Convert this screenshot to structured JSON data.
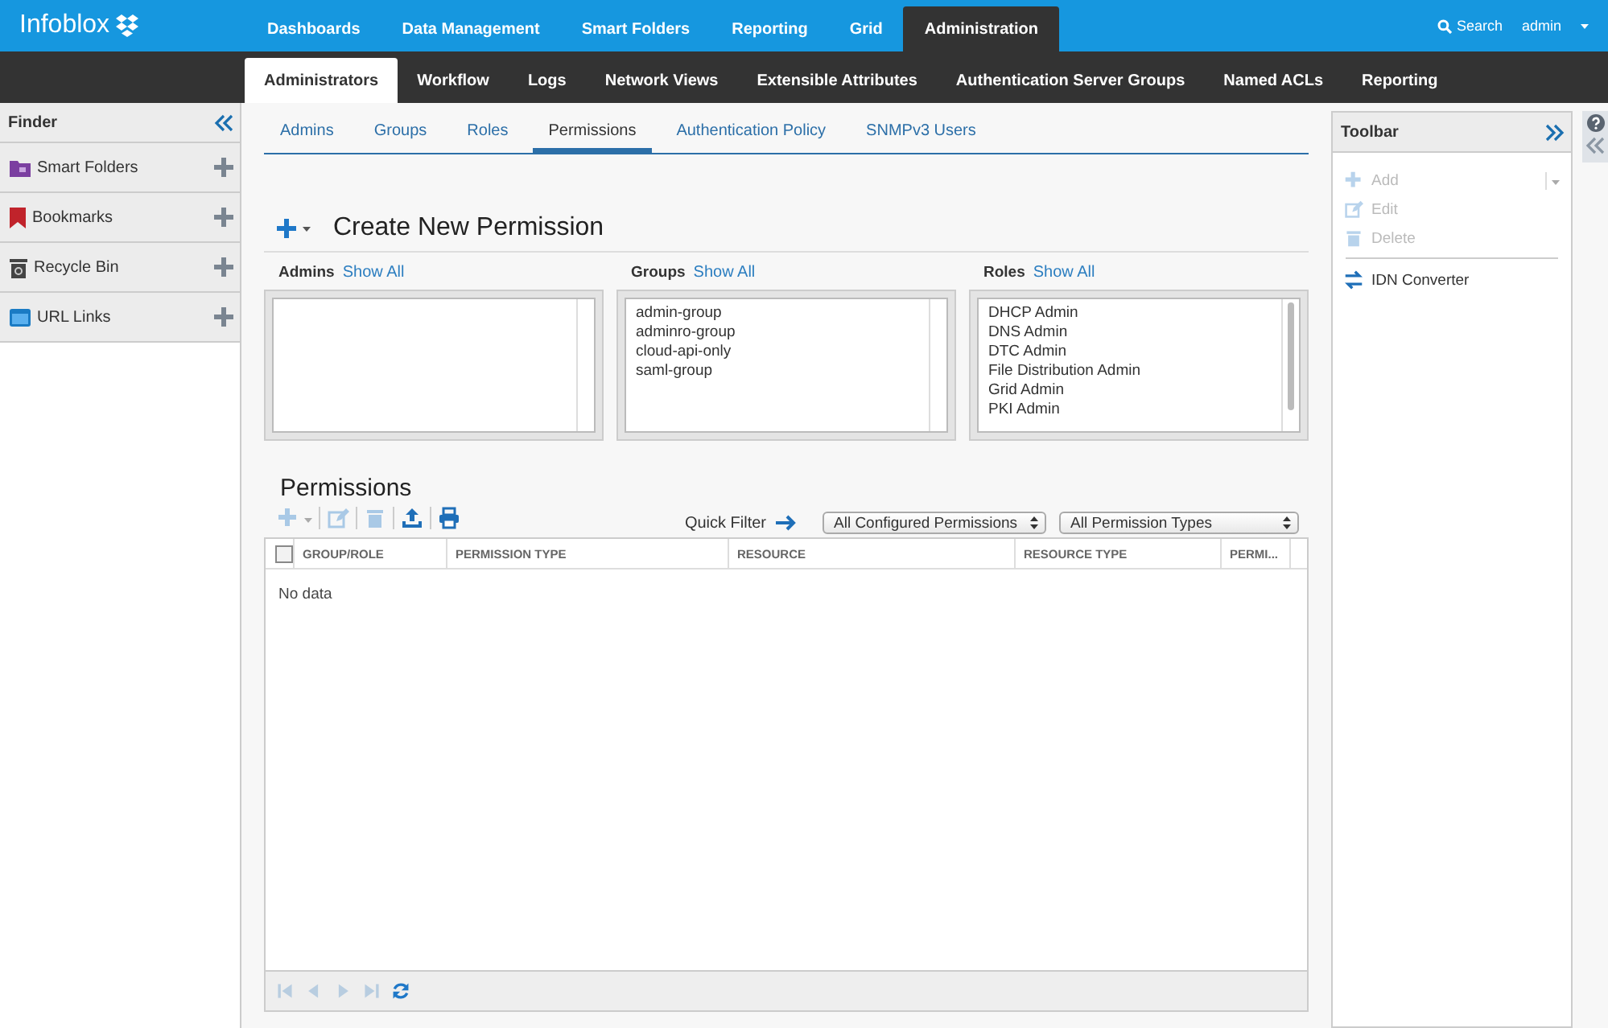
{
  "header": {
    "logo": "Infoblox",
    "nav": [
      {
        "label": "Dashboards",
        "selected": false
      },
      {
        "label": "Data Management",
        "selected": false
      },
      {
        "label": "Smart Folders",
        "selected": false
      },
      {
        "label": "Reporting",
        "selected": false
      },
      {
        "label": "Grid",
        "selected": false
      },
      {
        "label": "Administration",
        "selected": true
      }
    ],
    "search": "Search",
    "user": "admin"
  },
  "subnav": [
    {
      "label": "Administrators",
      "selected": true
    },
    {
      "label": "Workflow",
      "selected": false
    },
    {
      "label": "Logs",
      "selected": false
    },
    {
      "label": "Network Views",
      "selected": false
    },
    {
      "label": "Extensible Attributes",
      "selected": false
    },
    {
      "label": "Authentication Server Groups",
      "selected": false
    },
    {
      "label": "Named ACLs",
      "selected": false
    },
    {
      "label": "Reporting",
      "selected": false
    }
  ],
  "finder": {
    "title": "Finder",
    "items": [
      {
        "label": "Smart Folders",
        "kind": "folder"
      },
      {
        "label": "Bookmarks",
        "kind": "bookmark"
      },
      {
        "label": "Recycle Bin",
        "kind": "bin"
      },
      {
        "label": "URL Links",
        "kind": "link"
      }
    ]
  },
  "tabs": [
    {
      "label": "Admins",
      "selected": false
    },
    {
      "label": "Groups",
      "selected": false
    },
    {
      "label": "Roles",
      "selected": false
    },
    {
      "label": "Permissions",
      "selected": true
    },
    {
      "label": "Authentication Policy",
      "selected": false
    },
    {
      "label": "SNMPv3 Users",
      "selected": false
    }
  ],
  "create": {
    "title": "Create New Permission",
    "pickers": [
      {
        "label": "Admins",
        "link": "Show All"
      },
      {
        "label": "Groups",
        "link": "Show All",
        "items": [
          "admin-group",
          "adminro-group",
          "cloud-api-only",
          "saml-group"
        ]
      },
      {
        "label": "Roles",
        "link": "Show All",
        "items": [
          "DHCP Admin",
          "DNS Admin",
          "DTC Admin",
          "File Distribution Admin",
          "Grid Admin",
          "PKI Admin"
        ]
      }
    ]
  },
  "permissions": {
    "title": "Permissions",
    "tools": [
      {
        "kind": "add",
        "disabled": true
      },
      {
        "kind": "edit",
        "disabled": true
      },
      {
        "kind": "delete",
        "disabled": true
      },
      {
        "kind": "export",
        "disabled": false
      },
      {
        "kind": "print",
        "disabled": false
      }
    ],
    "quick_filter": "Quick Filter",
    "filters": [
      "All Configured Permissions",
      "All Permission Types"
    ],
    "select_all": {
      "checked": false
    },
    "columns": [
      "GROUP/ROLE",
      "PERMISSION TYPE",
      "RESOURCE",
      "RESOURCE TYPE",
      "PERMI..."
    ],
    "empty": "No data",
    "pager": [
      {
        "kind": "first",
        "disabled": true
      },
      {
        "kind": "prev",
        "disabled": true
      },
      {
        "kind": "next",
        "disabled": true
      },
      {
        "kind": "last",
        "disabled": true
      },
      {
        "kind": "refresh",
        "disabled": false
      }
    ]
  },
  "toolbar": {
    "title": "Toolbar",
    "items": [
      {
        "label": "Add",
        "kind": "add",
        "disabled": true
      },
      {
        "label": "Edit",
        "kind": "edit",
        "disabled": true
      },
      {
        "label": "Delete",
        "kind": "delete",
        "disabled": true
      },
      {
        "label": "IDN Converter",
        "kind": "convert",
        "disabled": false
      }
    ]
  }
}
